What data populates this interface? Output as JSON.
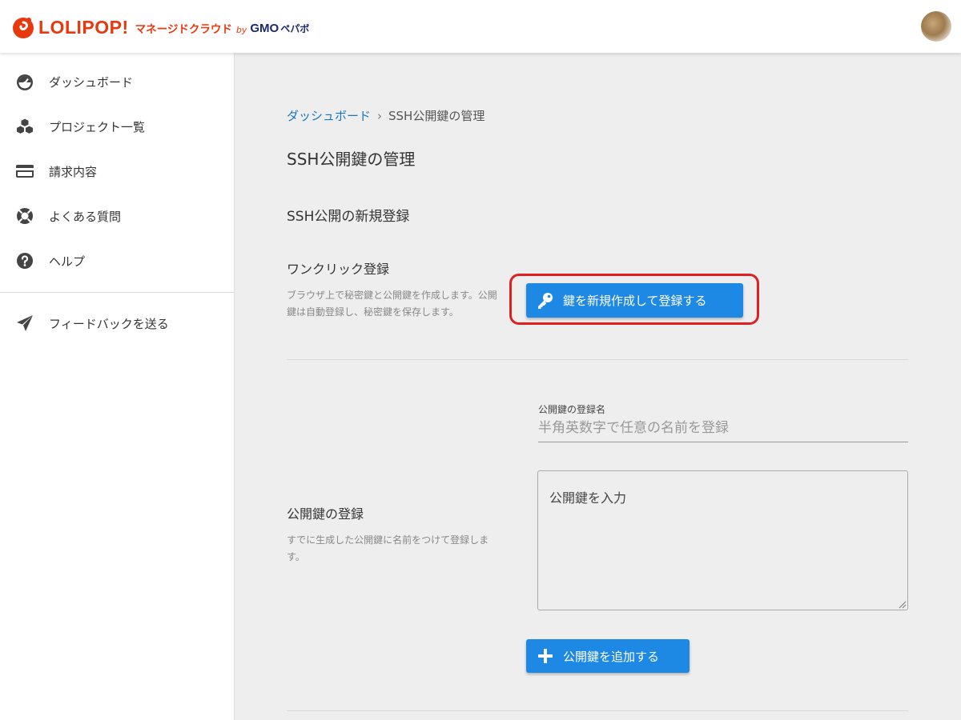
{
  "header": {
    "logo_text": "LOLIPOP!",
    "logo_sub": "マネージドクラウド",
    "logo_by": "by",
    "logo_gmo": "GMO",
    "logo_pepabo": "ペパボ",
    "brand_color": "#e8380d"
  },
  "sidebar": {
    "items": [
      {
        "label": "ダッシュボード",
        "icon": "dashboard-gauge-icon"
      },
      {
        "label": "プロジェクト一覧",
        "icon": "cubes-icon"
      },
      {
        "label": "請求内容",
        "icon": "credit-card-icon"
      },
      {
        "label": "よくある質問",
        "icon": "lifebuoy-icon"
      },
      {
        "label": "ヘルプ",
        "icon": "question-circle-icon"
      }
    ],
    "feedback": {
      "label": "フィードバックを送る",
      "icon": "paper-plane-icon"
    }
  },
  "breadcrumb": {
    "home": "ダッシュボード",
    "separator": "›",
    "current": "SSH公開鍵の管理"
  },
  "page": {
    "title": "SSH公開鍵の管理",
    "section_title": "SSH公開の新規登録"
  },
  "one_click": {
    "title": "ワンクリック登録",
    "description": "ブラウザ上で秘密鍵と公開鍵を作成します。公開鍵は自動登録し、秘密鍵を保存します。",
    "button_label": "鍵を新規作成して登録する",
    "button_icon": "key-icon"
  },
  "register": {
    "name_label": "公開鍵の登録名",
    "name_placeholder": "半角英数字で任意の名前を登録",
    "title": "公開鍵の登録",
    "description": "すでに生成した公開鍵に名前をつけて登録します。",
    "key_placeholder": "公開鍵を入力",
    "add_button_label": "公開鍵を追加する",
    "add_button_icon": "plus-icon"
  },
  "colors": {
    "accent": "#1e88e5",
    "link": "#1a76c0",
    "highlight": "#e02020"
  }
}
